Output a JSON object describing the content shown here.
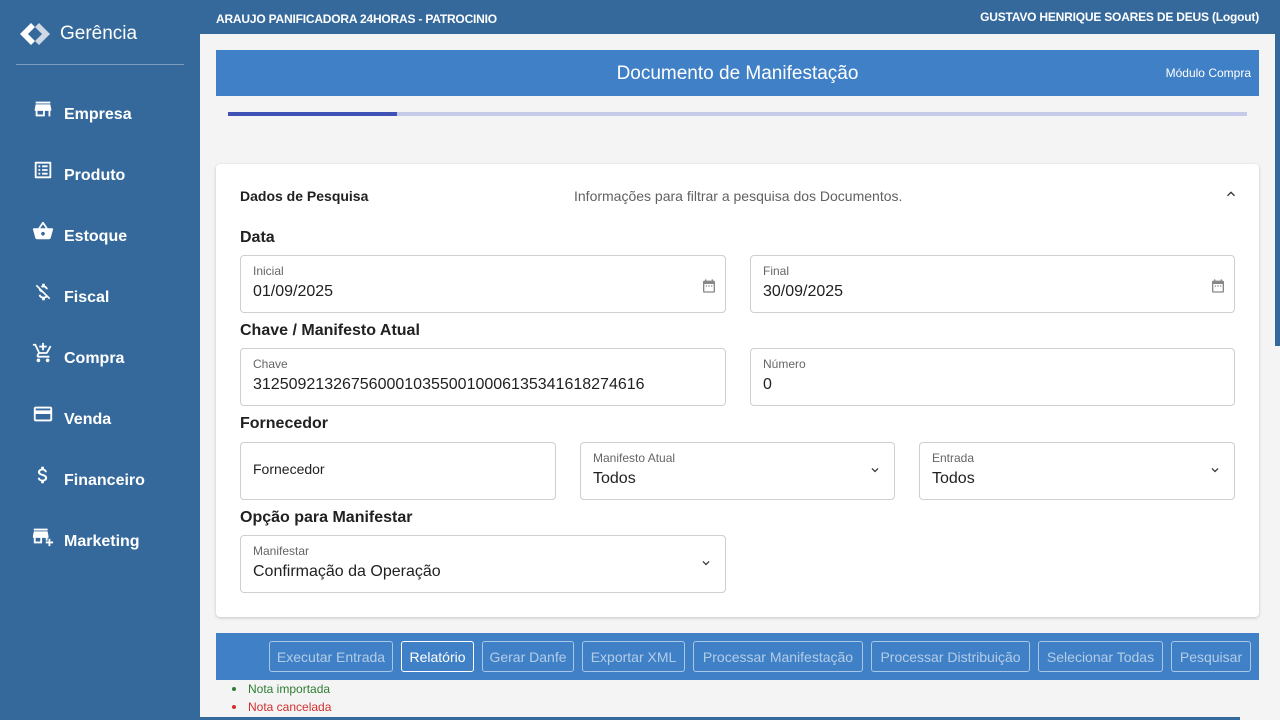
{
  "brand": {
    "name": "Gerência"
  },
  "topbar": {
    "company": "ARAUJO PANIFICADORA 24HORAS - PATROCINIO",
    "user": "GUSTAVO HENRIQUE SOARES DE DEUS (Logout)"
  },
  "sidebar": {
    "items": [
      {
        "label": "Empresa",
        "icon": "store-icon"
      },
      {
        "label": "Produto",
        "icon": "list-icon"
      },
      {
        "label": "Estoque",
        "icon": "basket-icon"
      },
      {
        "label": "Fiscal",
        "icon": "money-off-icon"
      },
      {
        "label": "Compra",
        "icon": "add-cart-icon"
      },
      {
        "label": "Venda",
        "icon": "credit-card-icon"
      },
      {
        "label": "Financeiro",
        "icon": "dollar-icon"
      },
      {
        "label": "Marketing",
        "icon": "add-business-icon"
      }
    ]
  },
  "header": {
    "title": "Documento de Manifestação",
    "module": "Módulo Compra"
  },
  "progress": {
    "value": 0.166
  },
  "search": {
    "title": "Dados de Pesquisa",
    "description": "Informações para filtrar a pesquisa dos Documentos.",
    "sections": {
      "date": "Data",
      "key": "Chave / Manifesto Atual",
      "supplier": "Fornecedor",
      "option": "Opção para Manifestar"
    },
    "fields": {
      "initial": {
        "label": "Inicial",
        "value": "01/09/2025"
      },
      "final": {
        "label": "Final",
        "value": "30/09/2025"
      },
      "chave": {
        "label": "Chave",
        "value": "31250921326756000103550010006135341618274616"
      },
      "numero": {
        "label": "Número",
        "value": "0"
      },
      "fornecedor": {
        "placeholder": "Fornecedor"
      },
      "manifesto_atual": {
        "label": "Manifesto Atual",
        "value": "Todos"
      },
      "entrada": {
        "label": "Entrada",
        "value": "Todos"
      },
      "manifestar": {
        "label": "Manifestar",
        "value": "Confirmação da Operação"
      }
    }
  },
  "toolbar": {
    "buttons": [
      {
        "label": "Executar Entrada",
        "active": false
      },
      {
        "label": "Relatório",
        "active": true
      },
      {
        "label": "Gerar Danfe",
        "active": false
      },
      {
        "label": "Exportar XML",
        "active": false
      },
      {
        "label": "Processar Manifestação",
        "active": false
      },
      {
        "label": "Processar Distribuição",
        "active": false
      },
      {
        "label": "Selecionar Todas",
        "active": false
      },
      {
        "label": "Pesquisar",
        "active": false
      }
    ]
  },
  "legend": [
    {
      "label": "Nota importada",
      "color": "#2e7d32"
    },
    {
      "label": "Nota cancelada",
      "color": "#d32f2f"
    }
  ],
  "colors": {
    "primary": "#35699c",
    "header": "#4080c6",
    "progress": "#3f51b5"
  }
}
